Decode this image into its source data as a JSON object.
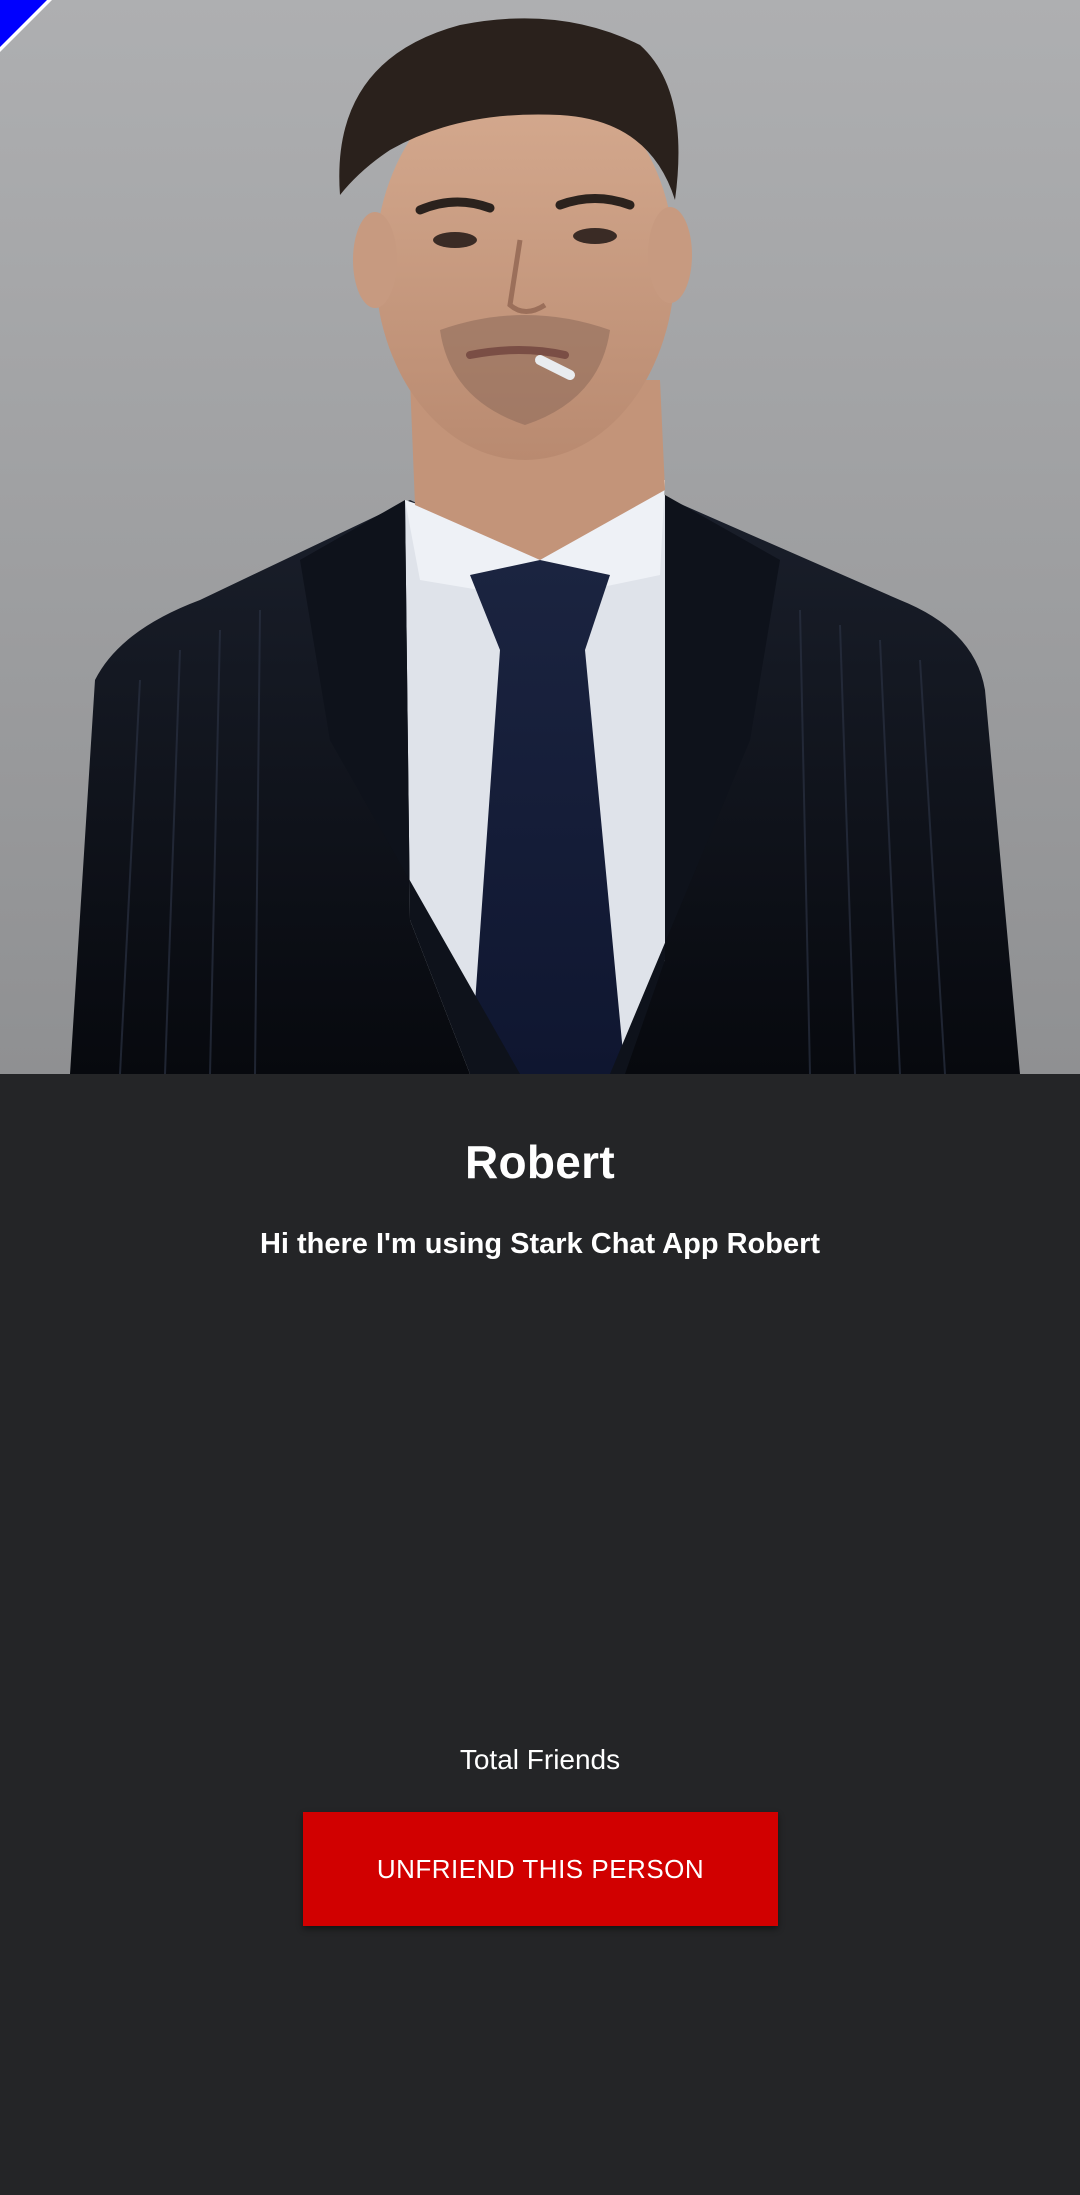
{
  "profile": {
    "name": "Robert",
    "status": "Hi there I'm using Stark Chat App Robert",
    "friends_label": "Total Friends",
    "action_label": "UNFRIEND THIS PERSON"
  },
  "colors": {
    "background": "#242527",
    "action_button": "#d10000",
    "text": "#ffffff",
    "corner_ribbon": "#0000ff"
  },
  "icons": {
    "corner": "debug-ribbon"
  }
}
